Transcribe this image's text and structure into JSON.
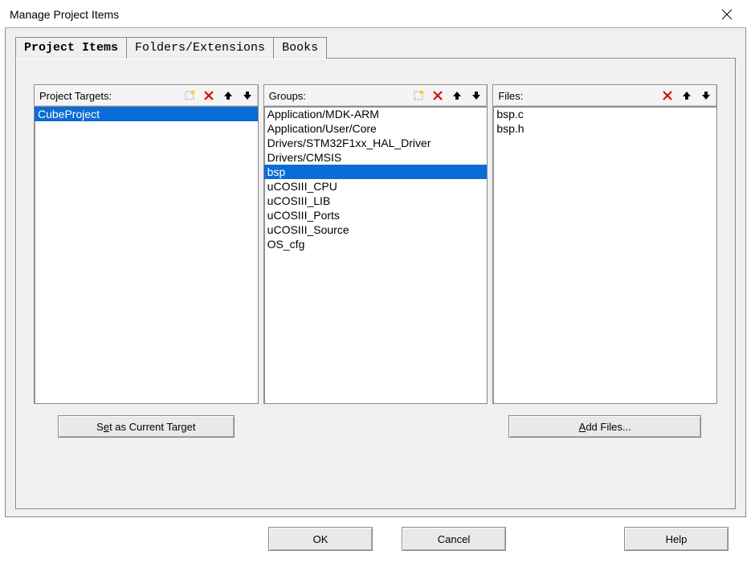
{
  "window": {
    "title": "Manage Project Items"
  },
  "tabs": {
    "project_items": "Project Items",
    "folders_extensions": "Folders/Extensions",
    "books": "Books"
  },
  "columns": {
    "targets": {
      "label": "Project Targets:"
    },
    "groups": {
      "label": "Groups:"
    },
    "files": {
      "label": "Files:"
    }
  },
  "targets": {
    "items": [
      "CubeProject"
    ],
    "selected_index": 0
  },
  "groups": {
    "items": [
      "Application/MDK-ARM",
      "Application/User/Core",
      "Drivers/STM32F1xx_HAL_Driver",
      "Drivers/CMSIS",
      "bsp",
      "uCOSIII_CPU",
      "uCOSIII_LIB",
      "uCOSIII_Ports",
      "uCOSIII_Source",
      "OS_cfg"
    ],
    "selected_index": 4
  },
  "files": {
    "items": [
      "bsp.c",
      "bsp.h"
    ],
    "selected_index": -1
  },
  "buttons": {
    "set_current_target_pre": "S",
    "set_current_target_u": "e",
    "set_current_target_post": "t as Current Target",
    "add_files_u": "A",
    "add_files_post": "dd Files...",
    "ok": "OK",
    "cancel": "Cancel",
    "help": "Help"
  }
}
